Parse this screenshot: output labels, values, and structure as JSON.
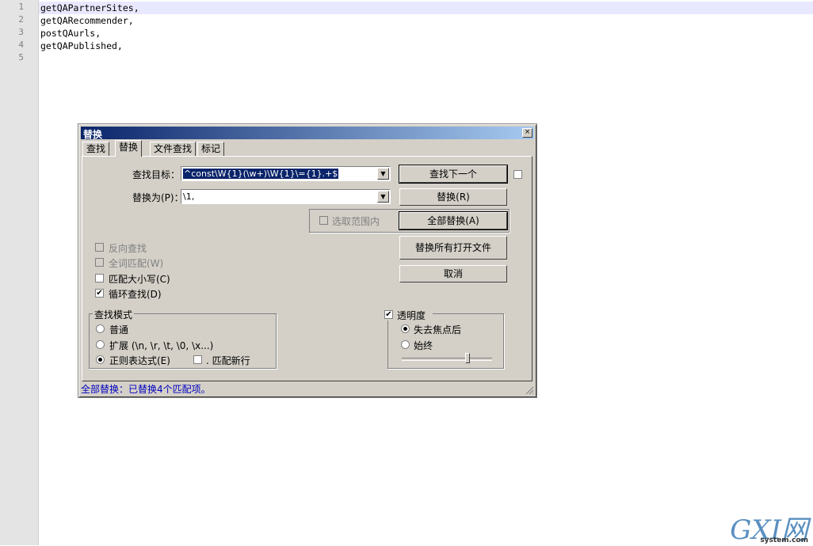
{
  "editor": {
    "line_numbers": [
      "1",
      "2",
      "3",
      "4",
      "5"
    ],
    "lines": [
      "getQAPartnerSites,",
      "getQARecommender,",
      "postQAurls,",
      "getQAPublished,",
      ""
    ]
  },
  "dialog": {
    "title": "替换",
    "close_glyph": "×",
    "tabs": [
      {
        "label": "查找"
      },
      {
        "label": "替换"
      },
      {
        "label": "文件查找"
      },
      {
        "label": "标记"
      }
    ],
    "find_label": "查找目标：",
    "find_value": "^const\\W{1}(\\w+)\\W{1}\\={1}.+$",
    "replace_label": "替换为(P)：",
    "replace_value": "\\1,",
    "buttons": {
      "find_next": "查找下一个",
      "replace": "替换(R)",
      "replace_all": "全部替换(A)",
      "replace_all_open": "替换所有打开文件",
      "cancel": "取消"
    },
    "in_selection": "选取范围内",
    "options": {
      "backward": "反向查找",
      "whole_word": "全词匹配(W)",
      "match_case": "匹配大小写(C)",
      "wrap": "循环查找(D)"
    },
    "search_mode": {
      "title": "查找模式",
      "normal": "普通",
      "extended": "扩展 (\\n, \\r, \\t, \\0, \\x...)",
      "regex": "正则表达式(E)",
      "dot_newline": ". 匹配新行"
    },
    "transparency": {
      "title": "透明度",
      "on_lose_focus": "失去焦点后",
      "always": "始终",
      "level": 0.73
    },
    "status": "全部替换：已替换4个匹配项。",
    "check_glyph": "✔"
  },
  "watermark": {
    "text": "GXI网",
    "sub": "system.com"
  },
  "colors": {
    "title_start": "#0a246a",
    "title_end": "#a6caf0",
    "status": "#0000c0",
    "dialog_bg": "#d4d0c8"
  }
}
